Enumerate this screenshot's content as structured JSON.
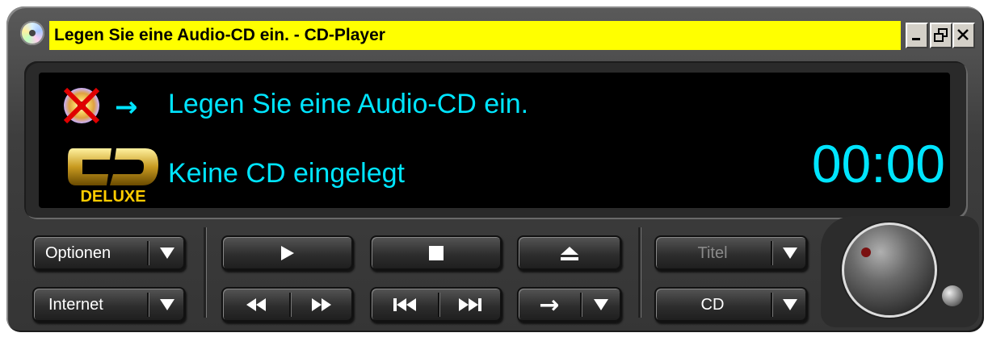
{
  "window": {
    "title": "Legen Sie eine Audio-CD ein. - CD-Player",
    "title_highlight_color": "#ffff00",
    "controls": [
      "minimize-icon",
      "restore-icon",
      "close-icon"
    ]
  },
  "display": {
    "line1": "Legen Sie eine Audio-CD ein.",
    "line2": "Keine CD eingelegt",
    "time": "00:00",
    "text_color": "#00e5ff",
    "logo_text": "DELUXE"
  },
  "left_controls": {
    "options_label": "Optionen",
    "internet_label": "Internet"
  },
  "right_controls": {
    "track_label": "Titel",
    "source_label": "CD"
  },
  "icons": {
    "no_cd": "no-cd-icon",
    "arrow": "→",
    "play": "play-icon",
    "stop": "stop-icon",
    "eject": "eject-icon",
    "rewind": "rewind-icon",
    "fast_forward": "fast-forward-icon",
    "previous_track": "previous-track-icon",
    "next_track": "next-track-icon",
    "mode_arrow": "→"
  }
}
